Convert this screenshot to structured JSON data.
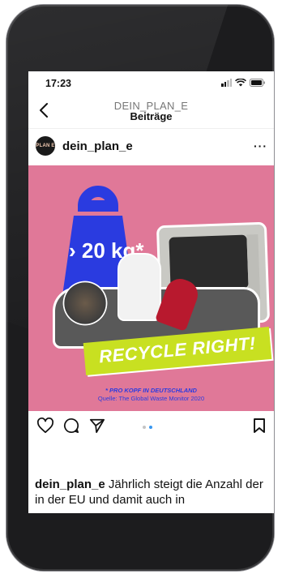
{
  "status_bar": {
    "time": "17:23"
  },
  "header": {
    "subtitle": "DEIN_PLAN_E",
    "title": "Beiträge"
  },
  "post": {
    "avatar_text": "PLAN E",
    "username": "dein_plan_e",
    "image": {
      "weight_label": "› 20 kg*",
      "banner_text": "RECYCLE RIGHT!",
      "footnote": "* PRO KOPF IN DEUTSCHLAND",
      "source": "Quelle: The Global Waste Monitor 2020",
      "bg_color": "#e07898",
      "weight_color": "#2a3be0",
      "banner_color": "#c8e021"
    },
    "carousel": {
      "count": 2,
      "active": 2
    },
    "caption_username": "dein_plan_e",
    "caption_text": " Jährlich steigt die Anzahl der in der EU und damit auch in"
  },
  "icons": [
    "back-chevron-icon",
    "more-icon",
    "heart-icon",
    "comment-icon",
    "share-icon",
    "bookmark-icon"
  ]
}
